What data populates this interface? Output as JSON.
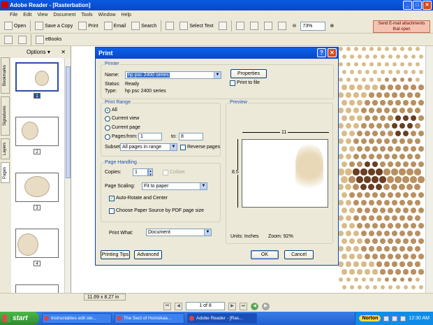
{
  "window": {
    "title": "Adobe Reader - [Rasterbation]"
  },
  "menu": [
    "File",
    "Edit",
    "View",
    "Document",
    "Tools",
    "Window",
    "Help"
  ],
  "toolbar": {
    "open": "Open",
    "save_copy": "Save a Copy",
    "print": "Print",
    "email": "Email",
    "search": "Search",
    "select_text": "Select Text",
    "zoom": "73%",
    "send_email_line1": "Send E-mail attachments",
    "send_email_line2": "that open",
    "ebooks": "eBooks"
  },
  "sidebar": {
    "options": "Options",
    "tabs": [
      "Bookmarks",
      "Signatures",
      "Layers",
      "Pages"
    ],
    "thumbs": [
      "1",
      "2",
      "3",
      "4"
    ]
  },
  "status": {
    "size": "11.69 x 8.27 in"
  },
  "nav": {
    "page": "1 of 8"
  },
  "taskbar": {
    "start": "start",
    "tasks": [
      "Instructables edit ste...",
      "The Sect of Homokaa...",
      "Adobe Reader - [Ras..."
    ],
    "norton": "Norton",
    "time": "12:30 AM"
  },
  "dialog": {
    "title": "Print",
    "printer": {
      "group": "Printer",
      "name_label": "Name:",
      "name_value": "hp psc 2400 series",
      "status_label": "Status:",
      "status_value": "Ready",
      "type_label": "Type:",
      "type_value": "hp psc 2400 series",
      "properties": "Properties",
      "print_to_file": "Print to file"
    },
    "range": {
      "group": "Print Range",
      "all": "All",
      "current_view": "Current view",
      "current_page": "Current page",
      "pages": "Pages",
      "from": "from:",
      "from_value": "1",
      "to": "to:",
      "to_value": "8",
      "subset_label": "Subset:",
      "subset_value": "All pages in range",
      "reverse": "Reverse pages"
    },
    "handling": {
      "group": "Page Handling",
      "copies_label": "Copies:",
      "copies_value": "1",
      "collate": "Collate",
      "scaling_label": "Page Scaling:",
      "scaling_value": "Fit to paper",
      "auto_rotate": "Auto-Rotate and Center",
      "choose_source": "Choose Paper Source by PDF page size"
    },
    "print_what_label": "Print What:",
    "print_what_value": "Document",
    "preview": {
      "group": "Preview",
      "width": "11",
      "height": "8.5",
      "units": "Units: Inches",
      "zoom": "Zoom:  92%"
    },
    "buttons": {
      "tips": "Printing Tips",
      "advanced": "Advanced",
      "ok": "OK",
      "cancel": "Cancel"
    }
  }
}
